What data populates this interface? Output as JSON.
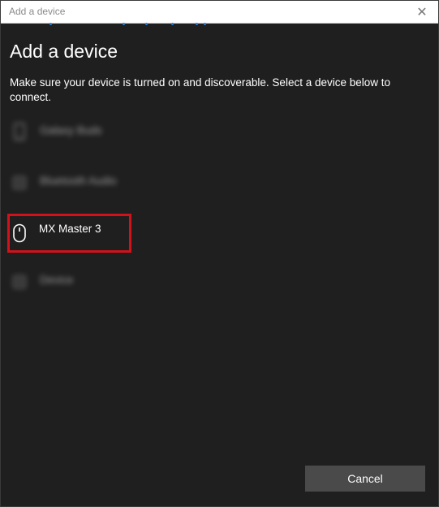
{
  "window": {
    "title": "Add a device",
    "close_glyph": "✕"
  },
  "main": {
    "heading": "Add a device",
    "description": "Make sure your device is turned on and discoverable. Select a device below to connect."
  },
  "devices": [
    {
      "label": "Galaxy Buds",
      "icon": "phone-icon",
      "blurred": true
    },
    {
      "label": "Bluetooth Audio",
      "icon": "audio-device-icon",
      "blurred": true
    },
    {
      "label": "MX Master 3",
      "icon": "mouse-icon",
      "blurred": false,
      "highlighted": true
    },
    {
      "label": "Device",
      "icon": "audio-device-icon",
      "blurred": true
    }
  ],
  "footer": {
    "cancel_label": "Cancel"
  },
  "colors": {
    "background": "#1f1f1f",
    "highlight": "#d2121b",
    "accent": "#2d7cd6",
    "button": "#4a4a4a"
  }
}
